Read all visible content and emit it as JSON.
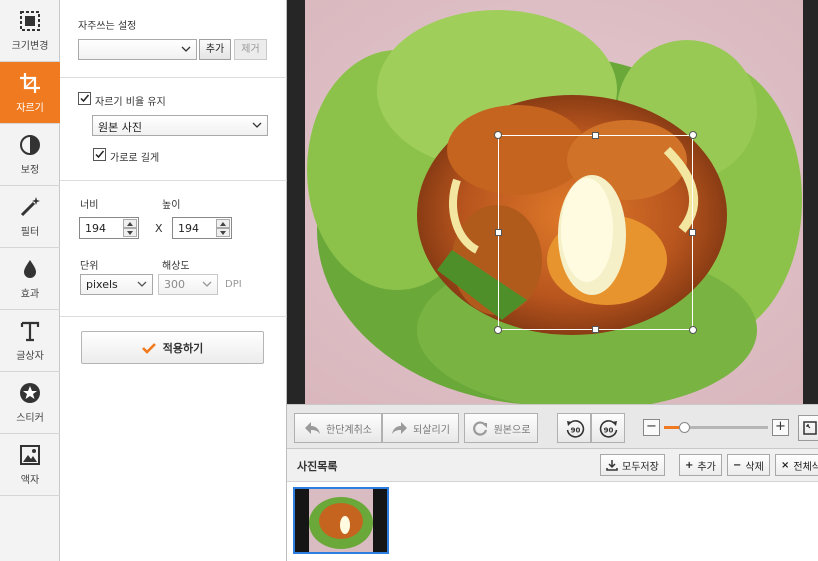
{
  "tools": [
    {
      "label": "크기변경",
      "icon": "resize-icon",
      "active": false
    },
    {
      "label": "자르기",
      "icon": "crop-icon",
      "active": true
    },
    {
      "label": "보정",
      "icon": "contrast-icon",
      "active": false
    },
    {
      "label": "필터",
      "icon": "magic-wand-icon",
      "active": false
    },
    {
      "label": "효과",
      "icon": "drop-icon",
      "active": false
    },
    {
      "label": "글상자",
      "icon": "text-icon",
      "active": false
    },
    {
      "label": "스티커",
      "icon": "star-icon",
      "active": false
    },
    {
      "label": "액자",
      "icon": "frame-icon",
      "active": false
    }
  ],
  "panel": {
    "favorites_label": "자주쓰는 설정",
    "favorites_value": "",
    "add_label": "추가",
    "remove_label": "제거",
    "keep_ratio_label": "자르기 비율 유지",
    "keep_ratio_checked": true,
    "ratio_value": "원본 사진",
    "landscape_label": "가로로 길게",
    "landscape_checked": true,
    "width_label": "너비",
    "height_label": "높이",
    "width_value": "194",
    "height_value": "194",
    "times_label": "X",
    "unit_label": "단위",
    "unit_value": "pixels",
    "resolution_label": "해상도",
    "resolution_value": "300",
    "dpi_label": "DPI",
    "apply_label": "적용하기"
  },
  "edit_bar": {
    "undo_label": "한단계취소",
    "redo_label": "되살리기",
    "original_label": "원본으로",
    "rotate_left_label": "90",
    "rotate_right_label": "90",
    "zoom_minus": "−",
    "zoom_plus": "+",
    "zoom_level": 0.08
  },
  "photo_list": {
    "title": "사진목록",
    "save_all_label": "모두저장",
    "add_label": "추가",
    "delete_label": "삭제",
    "delete_all_label": "전체삭"
  },
  "colors": {
    "accent": "#f07a1f",
    "selection": "#2e7de0"
  }
}
